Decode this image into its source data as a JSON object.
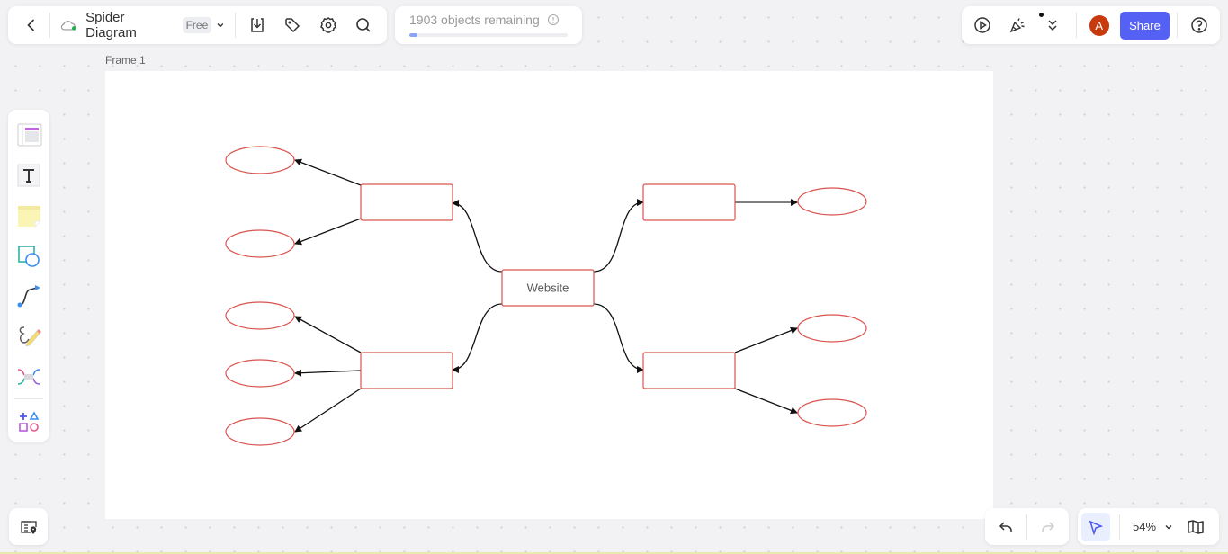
{
  "header": {
    "back_icon": "chevron-left-icon",
    "cloud_icon": "cloud-synced-icon",
    "title": "Spider Diagram",
    "plan_badge": "Free",
    "toolbar_icons": [
      "download-icon",
      "tag-icon",
      "gear-icon",
      "search-icon"
    ]
  },
  "objects": {
    "label": "1903 objects remaining",
    "used_fraction": 0.05,
    "accent": "#8aa5f5"
  },
  "top_right": {
    "icons": [
      "present-icon",
      "celebrate-icon",
      "expand-more-icon"
    ],
    "avatar_initial": "A",
    "avatar_color": "#c8390e",
    "share_label": "Share",
    "share_color": "#5561f5",
    "help_icon": "help-icon"
  },
  "frame": {
    "label": "Frame 1"
  },
  "diagram": {
    "center": {
      "label": "Website"
    },
    "node_stroke": "#d9534f",
    "branches": [
      {
        "id": "left-top",
        "label": "",
        "leaves": [
          "",
          ""
        ]
      },
      {
        "id": "left-bottom",
        "label": "",
        "leaves": [
          "",
          "",
          ""
        ]
      },
      {
        "id": "right-top",
        "label": "",
        "leaves": [
          ""
        ]
      },
      {
        "id": "right-bottom",
        "label": "",
        "leaves": [
          "",
          ""
        ]
      }
    ]
  },
  "left_toolbar": {
    "tools": [
      "template-icon",
      "text-icon",
      "sticky-note-icon",
      "shape-icon",
      "connector-icon",
      "pen-icon",
      "mindmap-icon",
      "more-shapes-icon"
    ]
  },
  "bottom": {
    "minimap_icon": "minimap-icon",
    "undo_icon": "undo-icon",
    "redo_icon": "redo-icon",
    "select_icon": "select-pointer-icon",
    "zoom_level": "54%",
    "map_icon": "map-icon"
  }
}
